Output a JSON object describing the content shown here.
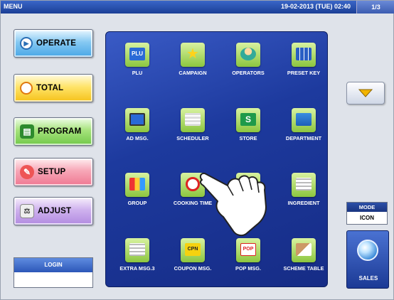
{
  "topbar": {
    "menu": "MENU",
    "datetime": "19-02-2013 (TUE) 02:40",
    "page": "1/3"
  },
  "nav": [
    {
      "id": "operate",
      "label": "OPERATE",
      "icon": "play-circle-icon"
    },
    {
      "id": "total",
      "label": "TOTAL",
      "icon": "clock-icon"
    },
    {
      "id": "program",
      "label": "PROGRAM",
      "icon": "book-icon"
    },
    {
      "id": "setup",
      "label": "SETUP",
      "icon": "wrench-icon"
    },
    {
      "id": "adjust",
      "label": "ADJUST",
      "icon": "scale-icon"
    }
  ],
  "login": {
    "label": "LOGIN"
  },
  "grid": [
    {
      "label": "PLU",
      "icon": "plu-icon"
    },
    {
      "label": "CAMPAIGN",
      "icon": "star-icon"
    },
    {
      "label": "OPERATORS",
      "icon": "operator-icon"
    },
    {
      "label": "PRESET KEY",
      "icon": "preset-key-icon"
    },
    {
      "label": "AD MSG.",
      "icon": "monitor-icon"
    },
    {
      "label": "SCHEDULER",
      "icon": "calendar-icon"
    },
    {
      "label": "STORE",
      "icon": "store-icon"
    },
    {
      "label": "DEPARTMENT",
      "icon": "folder-icon"
    },
    {
      "label": "GROUP",
      "icon": "group-icon"
    },
    {
      "label": "COOKING TIME",
      "icon": "timer-icon"
    },
    {
      "label": "",
      "icon": "hidden-icon"
    },
    {
      "label": "INGREDIENT",
      "icon": "ingredient-icon"
    },
    {
      "label": "EXTRA MSG.3",
      "icon": "message-icon"
    },
    {
      "label": "COUPON MSG.",
      "icon": "coupon-icon"
    },
    {
      "label": "POP MSG.",
      "icon": "pop-icon"
    },
    {
      "label": "SCHEME TABLE",
      "icon": "scheme-icon"
    }
  ],
  "mode": {
    "label": "MODE",
    "value": "ICON"
  },
  "sales": {
    "label": "SALES"
  },
  "colors": {
    "accent": "#1d3a9e",
    "tile": "#8cc63f"
  }
}
